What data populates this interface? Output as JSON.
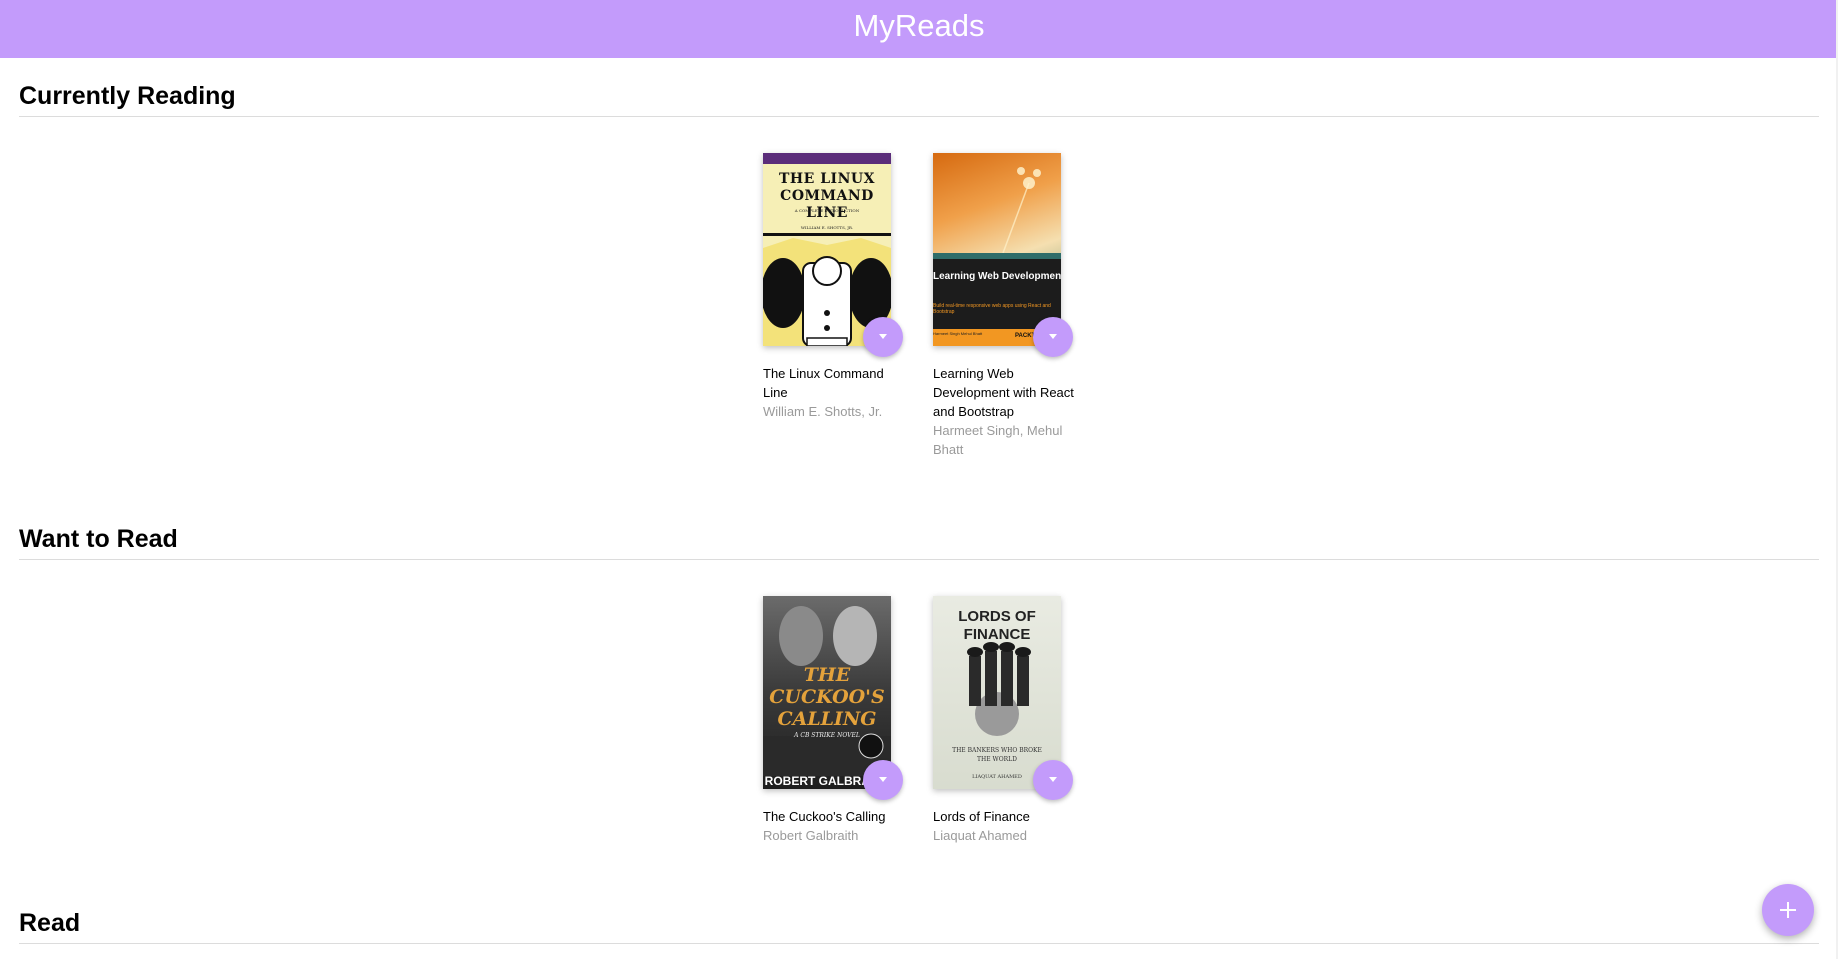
{
  "app": {
    "title": "MyReads",
    "accent_color": "#c39bfb"
  },
  "shelves": [
    {
      "title": "Currently Reading",
      "books": [
        {
          "title": "The Linux Command Line",
          "authors": "William E. Shotts, Jr.",
          "cover_text": "THE LINUX COMMAND LINE",
          "cover_subtext": "A COMPLETE INTRODUCTION",
          "cover_author": "WILLIAM E. SHOTTS, JR."
        },
        {
          "title": "Learning Web Development with React and Bootstrap",
          "authors": "Harmeet Singh, Mehul Bhatt",
          "cover_text": "Learning Web Development with React and Bootstrap",
          "cover_subtext": "Build real-time responsive web apps using React and Bootstrap",
          "cover_author": "Harmeet Singh Mehul Bhatt",
          "cover_publisher": "PACKT"
        }
      ]
    },
    {
      "title": "Want to Read",
      "books": [
        {
          "title": "The Cuckoo's Calling",
          "authors": "Robert Galbraith",
          "cover_text": "THE CUCKOO'S CALLING",
          "cover_subtext": "A CB STRIKE NOVEL",
          "cover_author": "ROBERT GALBRAITH"
        },
        {
          "title": "Lords of Finance",
          "authors": "Liaquat Ahamed",
          "cover_text": "LORDS OF FINANCE",
          "cover_subtext": "THE BANKERS WHO BROKE THE WORLD",
          "cover_author": "LIAQUAT AHAMED"
        }
      ]
    },
    {
      "title": "Read",
      "books": []
    }
  ],
  "icons": {
    "shelf_changer": "chevron-down-icon",
    "add_search": "plus-icon"
  }
}
